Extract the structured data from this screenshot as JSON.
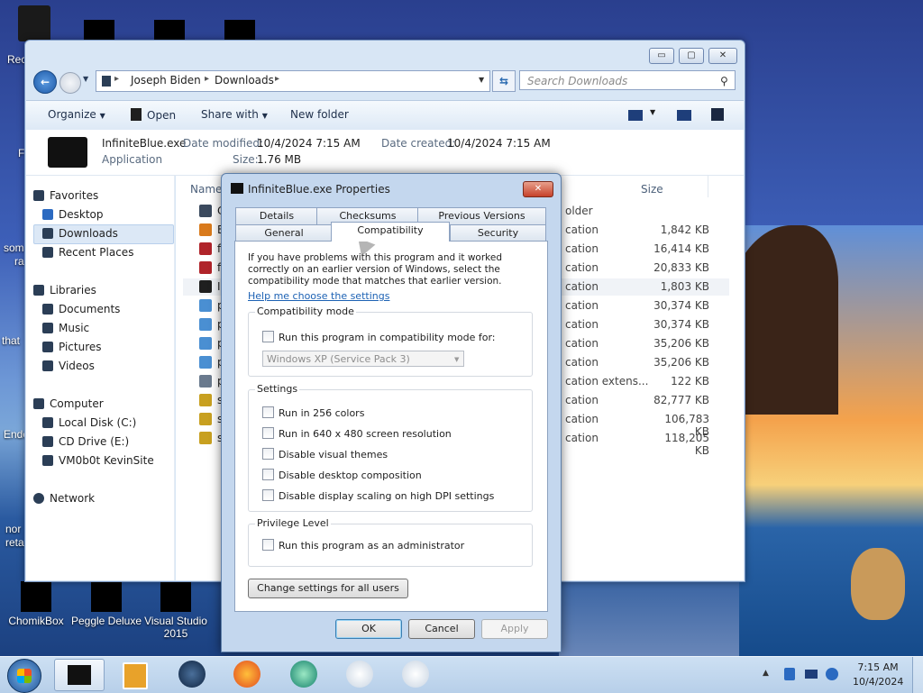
{
  "desktop": {
    "icons": [
      {
        "label": "ChomikBox"
      },
      {
        "label": "Peggle Deluxe"
      },
      {
        "label": "Visual Studio 2015"
      }
    ],
    "clipped_labels": [
      "Rec",
      "F",
      "som",
      "ra",
      "that",
      "Endo",
      "nor",
      "reta"
    ]
  },
  "explorer": {
    "window_buttons": {
      "minimize": "▭",
      "maximize": "▢",
      "close": "✕"
    },
    "breadcrumb": [
      "Joseph Biden",
      "Downloads"
    ],
    "search_placeholder": "Search Downloads",
    "toolbar": {
      "organize": "Organize",
      "open": "Open",
      "share_with": "Share with",
      "new_folder": "New folder"
    },
    "details": {
      "file_name": "InfiniteBlue.exe",
      "file_type": "Application",
      "date_modified_label": "Date modified:",
      "date_modified": "10/4/2024 7:15 AM",
      "date_created_label": "Date created:",
      "date_created": "10/4/2024 7:15 AM",
      "size_label": "Size:",
      "size": "1.76 MB"
    },
    "nav": {
      "favorites": "Favorites",
      "desktop": "Desktop",
      "downloads": "Downloads",
      "recent_places": "Recent Places",
      "libraries": "Libraries",
      "documents": "Documents",
      "music": "Music",
      "pictures": "Pictures",
      "videos": "Videos",
      "computer": "Computer",
      "local_disk": "Local Disk (C:)",
      "cd_drive": "CD Drive (E:)",
      "vm_share": "VM0b0t KevinSite",
      "network": "Network"
    },
    "columns": {
      "name": "Name",
      "size": "Size"
    },
    "rows": [
      {
        "name": "Ch",
        "type": "older",
        "size": "",
        "icon_color": "#3b4a5e"
      },
      {
        "name": "Ev",
        "type": "cation",
        "size": "1,842 KB",
        "icon_color": "#d97a1c"
      },
      {
        "name": "fla",
        "type": "cation",
        "size": "16,414 KB",
        "icon_color": "#b0242a"
      },
      {
        "name": "fla",
        "type": "cation",
        "size": "20,833 KB",
        "icon_color": "#b0242a"
      },
      {
        "name": "Inf",
        "type": "cation",
        "size": "1,803 KB",
        "icon_color": "#1f1f1f"
      },
      {
        "name": "pa",
        "type": "cation",
        "size": "30,374 KB",
        "icon_color": "#4a8fd2"
      },
      {
        "name": "pa",
        "type": "cation",
        "size": "30,374 KB",
        "icon_color": "#4a8fd2"
      },
      {
        "name": "pa",
        "type": "cation",
        "size": "35,206 KB",
        "icon_color": "#4a8fd2"
      },
      {
        "name": "pa",
        "type": "cation",
        "size": "35,206 KB",
        "icon_color": "#4a8fd2"
      },
      {
        "name": "pr",
        "type": "cation extens...",
        "size": "122 KB",
        "icon_color": "#6a7a8e"
      },
      {
        "name": "su",
        "type": "cation",
        "size": "82,777 KB",
        "icon_color": "#c8a020"
      },
      {
        "name": "su",
        "type": "cation",
        "size": "106,783 KB",
        "icon_color": "#c8a020"
      },
      {
        "name": "su",
        "type": "cation",
        "size": "118,205 KB",
        "icon_color": "#c8a020"
      }
    ]
  },
  "dialog": {
    "title": "InfiniteBlue.exe Properties",
    "close": "✕",
    "tabs_back": [
      "Details",
      "Checksums",
      "Previous Versions"
    ],
    "tabs_front": [
      "General",
      "Compatibility",
      "Security"
    ],
    "active_tab": "Compatibility",
    "intro": "If you have problems with this program and it worked correctly on an earlier version of Windows, select the compatibility mode that matches that earlier version.",
    "help_link": "Help me choose the settings",
    "compat_group": "Compatibility mode",
    "compat_checkbox": "Run this program in compatibility mode for:",
    "compat_select": "Windows XP (Service Pack 3)",
    "settings_group": "Settings",
    "settings": [
      "Run in 256 colors",
      "Run in 640 x 480 screen resolution",
      "Disable visual themes",
      "Disable desktop composition",
      "Disable display scaling on high DPI settings"
    ],
    "privilege_group": "Privilege Level",
    "privilege_checkbox": "Run this program as an administrator",
    "change_all_users": "Change settings for all users",
    "ok": "OK",
    "cancel": "Cancel",
    "apply": "Apply"
  },
  "taskbar": {
    "time": "7:15 AM",
    "date": "10/4/2024",
    "tray_arrow": "▲"
  }
}
